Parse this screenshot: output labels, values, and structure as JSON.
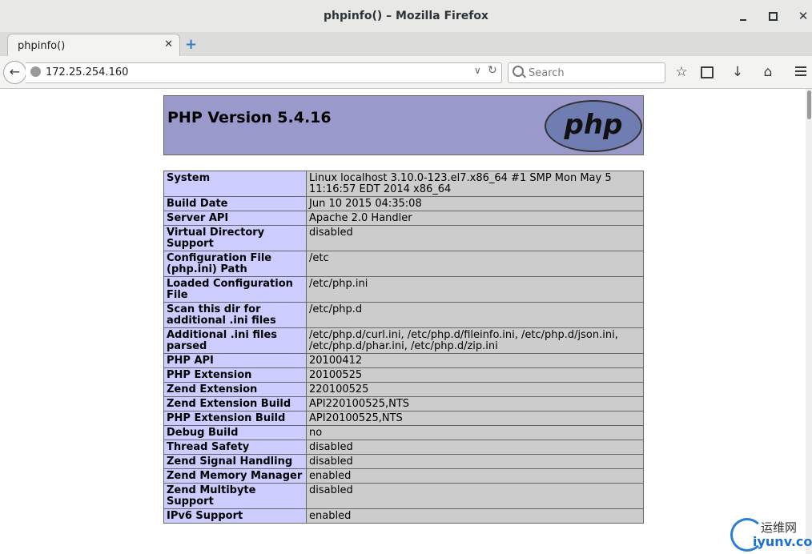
{
  "window": {
    "title": "phpinfo() – Mozilla Firefox",
    "minimize_icon": "minimize-icon",
    "maximize_icon": "maximize-icon",
    "close_icon": "close-icon"
  },
  "tabs": [
    {
      "label": "phpinfo()",
      "close": "✕"
    }
  ],
  "new_tab": "+",
  "nav": {
    "back": "←",
    "url": "172.25.254.160",
    "url_dropdown": "∨",
    "reload": "↻",
    "search_placeholder": "Search",
    "star": "☆",
    "download": "↓",
    "home": "⌂"
  },
  "page": {
    "version": "PHP Version 5.4.16",
    "logo": "php",
    "rows": [
      {
        "key": "System",
        "value": "Linux localhost 3.10.0-123.el7.x86_64 #1 SMP Mon May 5 11:16:57 EDT 2014 x86_64"
      },
      {
        "key": "Build Date",
        "value": "Jun 10 2015 04:35:08"
      },
      {
        "key": "Server API",
        "value": "Apache 2.0 Handler"
      },
      {
        "key": "Virtual Directory Support",
        "value": "disabled"
      },
      {
        "key": "Configuration File (php.ini) Path",
        "value": "/etc"
      },
      {
        "key": "Loaded Configuration File",
        "value": "/etc/php.ini"
      },
      {
        "key": "Scan this dir for additional .ini files",
        "value": "/etc/php.d"
      },
      {
        "key": "Additional .ini files parsed",
        "value": "/etc/php.d/curl.ini, /etc/php.d/fileinfo.ini, /etc/php.d/json.ini, /etc/php.d/phar.ini, /etc/php.d/zip.ini"
      },
      {
        "key": "PHP API",
        "value": "20100412"
      },
      {
        "key": "PHP Extension",
        "value": "20100525"
      },
      {
        "key": "Zend Extension",
        "value": "220100525"
      },
      {
        "key": "Zend Extension Build",
        "value": "API220100525,NTS"
      },
      {
        "key": "PHP Extension Build",
        "value": "API20100525,NTS"
      },
      {
        "key": "Debug Build",
        "value": "no"
      },
      {
        "key": "Thread Safety",
        "value": "disabled"
      },
      {
        "key": "Zend Signal Handling",
        "value": "disabled"
      },
      {
        "key": "Zend Memory Manager",
        "value": "enabled"
      },
      {
        "key": "Zend Multibyte Support",
        "value": "disabled"
      },
      {
        "key": "IPv6 Support",
        "value": "enabled"
      }
    ]
  },
  "watermark": {
    "cn": "运维网",
    "en": "iyunv.com"
  },
  "colors": {
    "php_header": "#9999cc",
    "key_cell": "#ccccff",
    "value_cell": "#cccccc"
  }
}
